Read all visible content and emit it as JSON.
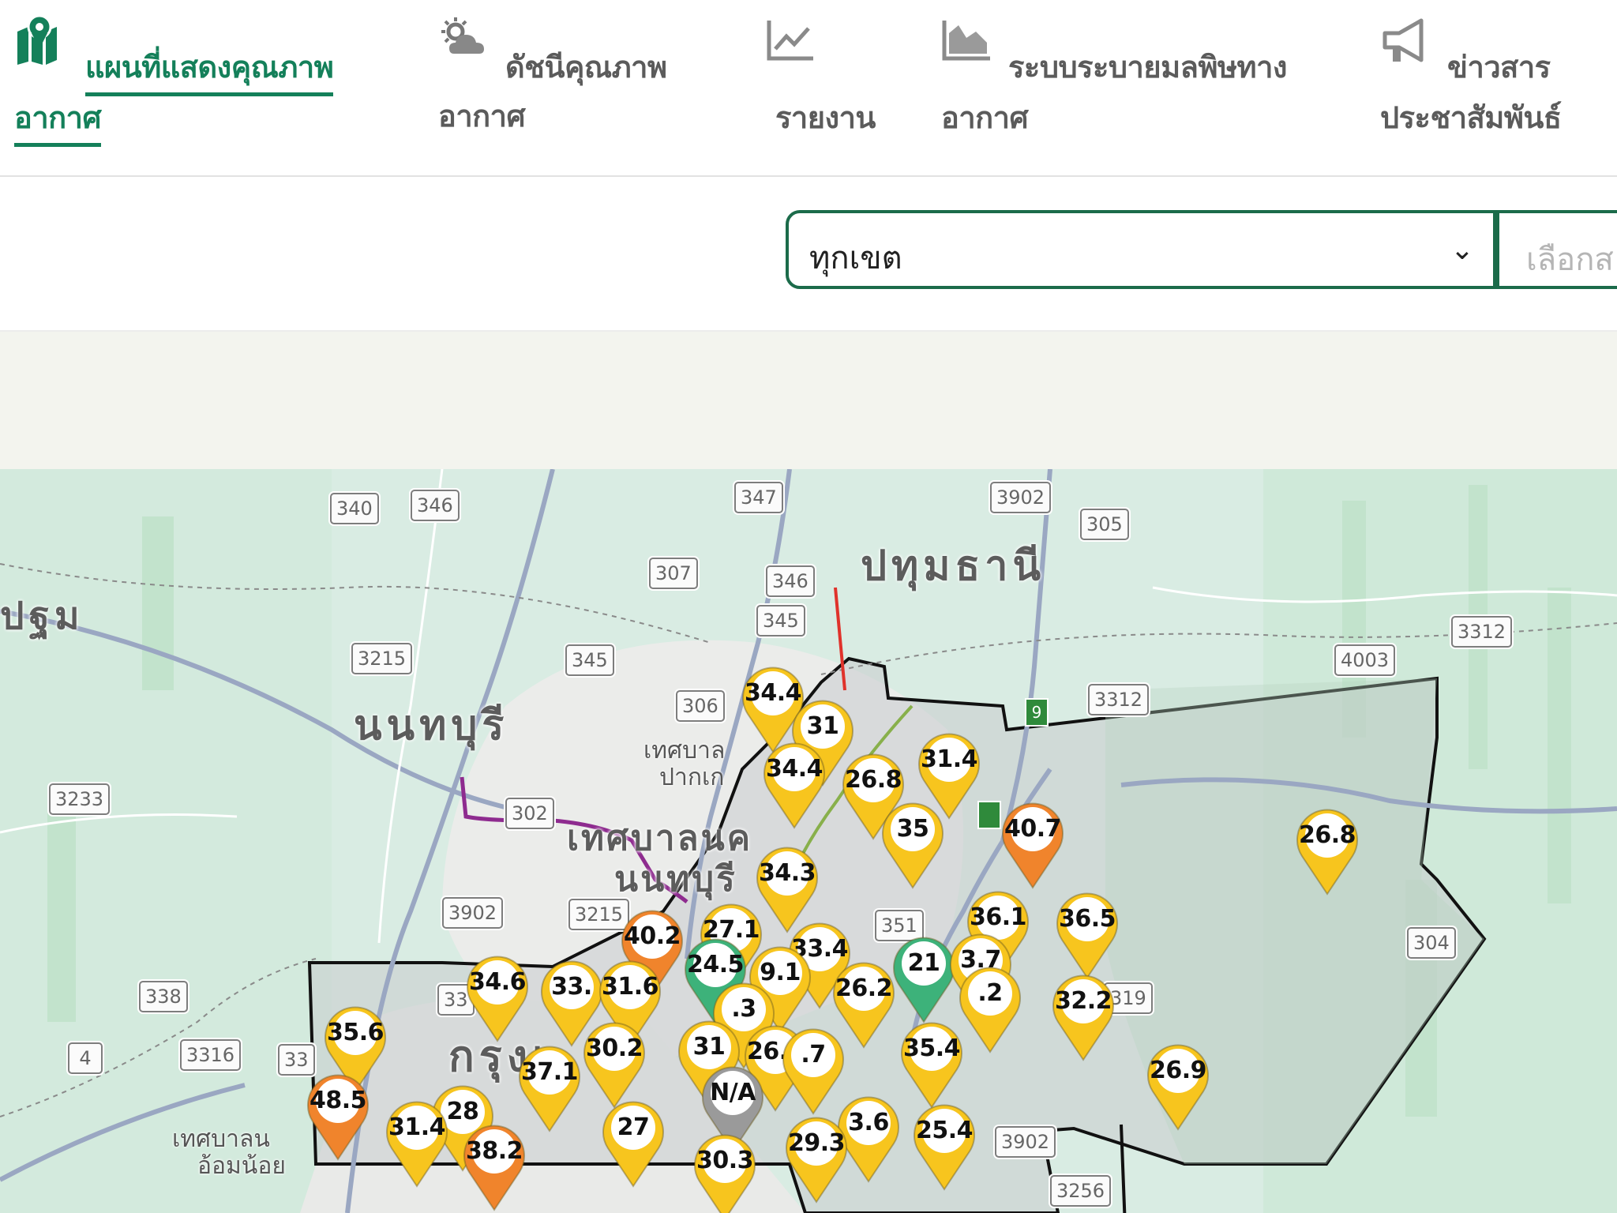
{
  "nav": {
    "items": [
      {
        "line1": "แผนที่แสดงคุณภาพ",
        "line2": "อากาศ",
        "icon": "map-pin-icon",
        "active": true
      },
      {
        "line1": "ดัชนีคุณภาพ",
        "line2": "อากาศ",
        "icon": "weather-cloud-sun-icon",
        "active": false
      },
      {
        "line1": "",
        "line2": "รายงาน",
        "icon": "line-chart-icon",
        "active": false
      },
      {
        "line1": "ระบบระบายมลพิษทาง",
        "line2": "อากาศ",
        "icon": "area-chart-icon",
        "active": false
      },
      {
        "line1": "ข่าวสาร",
        "line2": "ประชาสัมพันธ์",
        "icon": "megaphone-icon",
        "active": false
      }
    ]
  },
  "filters": {
    "district_value": "ทุกเขต",
    "station_placeholder": "เลือกส"
  },
  "map": {
    "places": {
      "pathum_thani": "ปทุมธานี",
      "nonthaburi": "นนทบุรี",
      "nakhon_pathom_fragment": "ปฐม",
      "bangkok_fragment": "กรุงเ",
      "nonthaburi_city_1": "เทศบาลนค",
      "nonthaburi_city_2": "นนทบุรี",
      "pakkret_1": "เทศบาล",
      "pakkret_2": "ปากเก",
      "omnoi_1": "เทศบาลน",
      "omnoi_2": "อ้อมน้อย"
    },
    "road_shields": [
      "340",
      "346",
      "347",
      "3902",
      "305",
      "307",
      "346",
      "345",
      "3312",
      "4003",
      "3312",
      "3215",
      "345",
      "306",
      "302",
      "3233",
      "3902",
      "3215",
      "351",
      "304",
      "338",
      "3316",
      "4",
      "3902",
      "3256",
      "319",
      "33",
      "33"
    ],
    "sign_digit": "9",
    "markers": [
      {
        "value": "34.4",
        "color": "#f7c51e"
      },
      {
        "value": "31",
        "color": "#f7c51e"
      },
      {
        "value": "31.4",
        "color": "#f7c51e"
      },
      {
        "value": "34.4",
        "color": "#f7c51e"
      },
      {
        "value": "26.8",
        "color": "#f7c51e"
      },
      {
        "value": "40.7",
        "color": "#f0842c"
      },
      {
        "value": "35",
        "color": "#f7c51e"
      },
      {
        "value": "26.8",
        "color": "#f7c51e"
      },
      {
        "value": "34.3",
        "color": "#f7c51e"
      },
      {
        "value": "36.1",
        "color": "#f7c51e"
      },
      {
        "value": "36.5",
        "color": "#f7c51e"
      },
      {
        "value": "27.1",
        "color": "#f7c51e"
      },
      {
        "value": "40.2",
        "color": "#f0842c"
      },
      {
        "value": "33.4",
        "color": "#f7c51e"
      },
      {
        "value": "34.6",
        "color": "#f7c51e"
      },
      {
        "value": "24.5",
        "color": "#3db27a"
      },
      {
        "value": "21",
        "color": "#3db27a"
      },
      {
        "value": "3.7",
        "color": "#f7c51e"
      },
      {
        "value": "33.",
        "color": "#f7c51e"
      },
      {
        "value": "31.6",
        "color": "#f7c51e"
      },
      {
        "value": "9.1",
        "color": "#f7c51e"
      },
      {
        "value": "26.2",
        "color": "#f7c51e"
      },
      {
        "value": ".2",
        "color": "#f7c51e"
      },
      {
        "value": "32.2",
        "color": "#f7c51e"
      },
      {
        "value": "35.6",
        "color": "#f7c51e"
      },
      {
        "value": ".3",
        "color": "#f7c51e"
      },
      {
        "value": "30.2",
        "color": "#f7c51e"
      },
      {
        "value": "37.1",
        "color": "#f7c51e"
      },
      {
        "value": "31",
        "color": "#f7c51e"
      },
      {
        "value": "26.4",
        "color": "#f7c51e"
      },
      {
        "value": ".7",
        "color": "#f7c51e"
      },
      {
        "value": "35.4",
        "color": "#f7c51e"
      },
      {
        "value": "26.9",
        "color": "#f7c51e"
      },
      {
        "value": "48.5",
        "color": "#f0842c"
      },
      {
        "value": "28",
        "color": "#f7c51e"
      },
      {
        "value": "N/A",
        "color": "#9a9a9a"
      },
      {
        "value": "27",
        "color": "#f7c51e"
      },
      {
        "value": "31.4",
        "color": "#f7c51e"
      },
      {
        "value": "3.6",
        "color": "#f7c51e"
      },
      {
        "value": "25.4",
        "color": "#f7c51e"
      },
      {
        "value": "38.2",
        "color": "#f0842c"
      },
      {
        "value": "29.3",
        "color": "#f7c51e"
      },
      {
        "value": "30.3",
        "color": "#f7c51e"
      }
    ]
  }
}
